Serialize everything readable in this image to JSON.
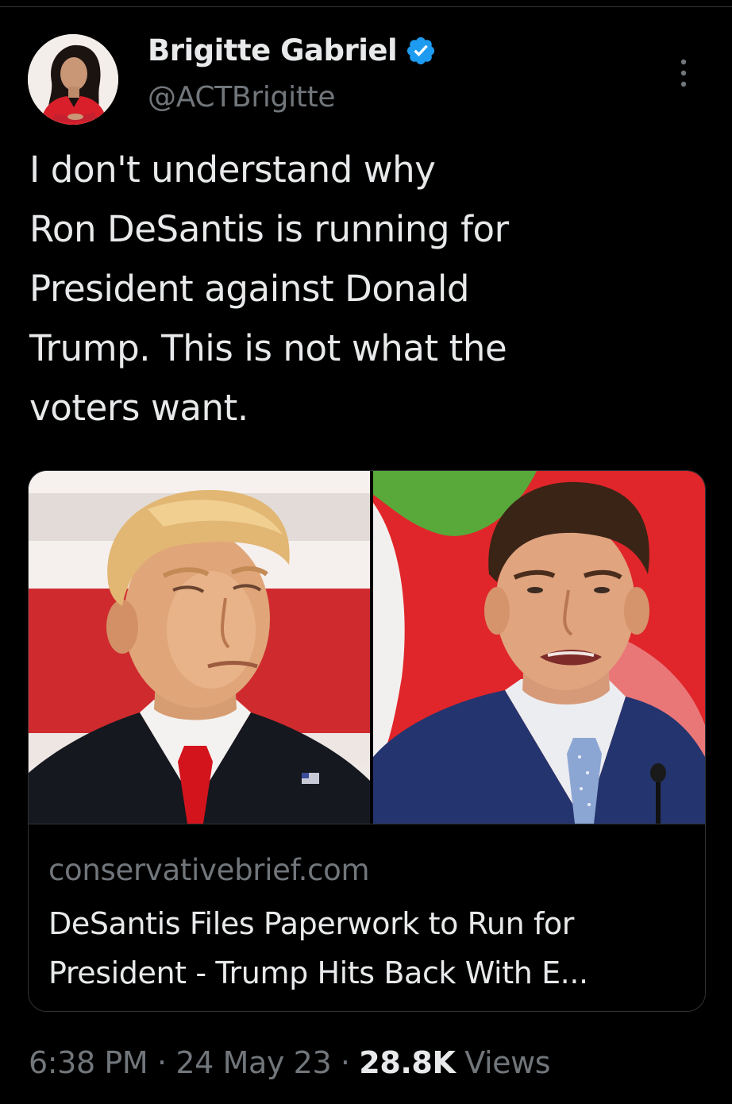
{
  "author": {
    "display_name": "Brigitte Gabriel",
    "handle": "@ACTBrigitte",
    "verified": true
  },
  "tweet": {
    "text": "I don't understand why\nRon DeSantis is running for\nPresident against Donald\nTrump. This is not what the\nvoters want."
  },
  "link_card": {
    "domain": "conservativebrief.com",
    "title": "DeSantis Files Paperwork to Run for President - Trump Hits Back With E..."
  },
  "meta": {
    "time": "6:38 PM",
    "separator": "·",
    "date": "24 May 23",
    "views_count": "28.8K",
    "views_label": "Views"
  },
  "colors": {
    "background": "#000000",
    "text_primary": "#e7e9ea",
    "text_secondary": "#71767b",
    "verified_blue": "#1d9bf0",
    "border": "#2f3336"
  },
  "icons": {
    "verified": "verified-badge-icon",
    "more": "more-options-icon"
  }
}
